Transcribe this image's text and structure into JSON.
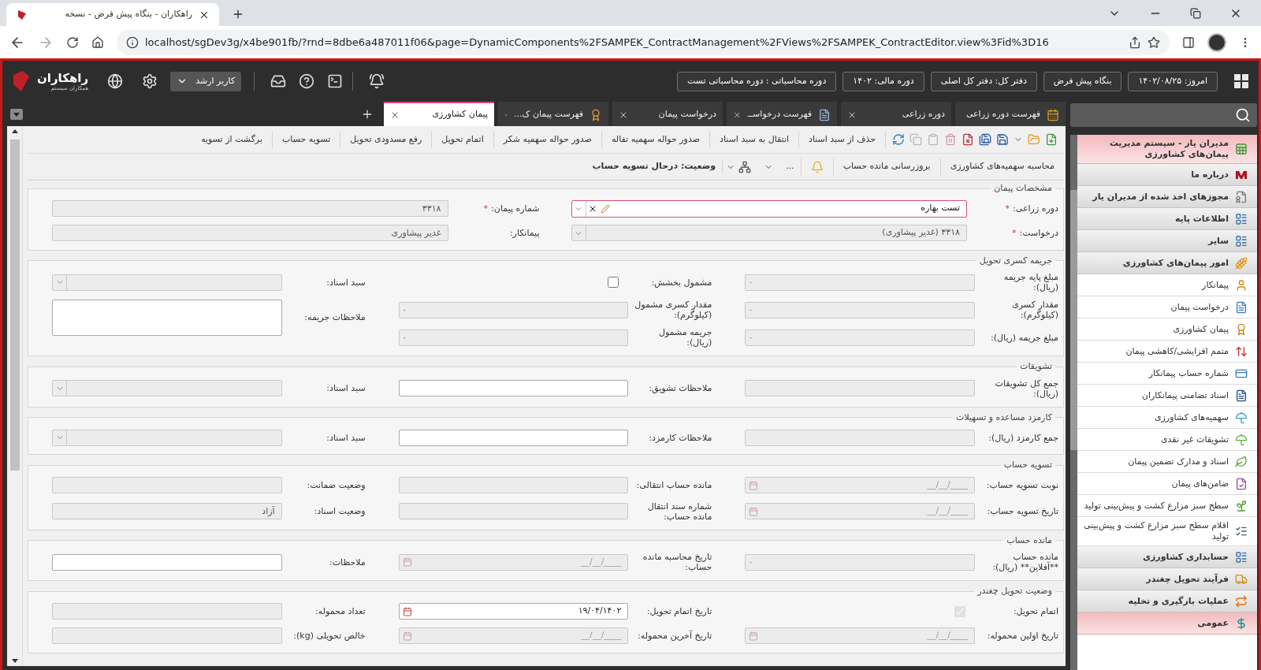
{
  "browser": {
    "tab_title": "راهکاران - بنگاه پیش فرض - نسخه",
    "url": "localhost/sgDev3g/x4be901fb/?rnd=8dbe6a487011f06&page=DynamicComponents%2FSAMPEK_ContractManagement%2FViews%2FSAMPEK_ContractEditor.view%3Fid%3D16"
  },
  "app_header": {
    "logo_title": "راهکاران",
    "logo_subtitle": "همکاران سیستم",
    "user_menu": "کاربر ارشد",
    "info": [
      "امروز: ۱۴۰۲/۰۸/۲۵",
      "بنگاه پیش فرض",
      "دفتر کل: دفتر کل اصلی",
      "دوره مالی: ۱۴۰۲",
      "دوره محاسباتی : دوره محاسباتی تست"
    ]
  },
  "doc_tabs": [
    {
      "label": "فهرست دوره زراعی",
      "selected": false
    },
    {
      "label": "دوره زراعی",
      "selected": false
    },
    {
      "label": "فهرست درخواســ",
      "selected": false
    },
    {
      "label": "درخواست پیمان",
      "selected": false
    },
    {
      "label": "فهرست پیمان ک...",
      "selected": false
    },
    {
      "label": "پیمان کشاورزی",
      "selected": true
    }
  ],
  "toolbar": {
    "row_1": [
      "حذف از سبد اسناد",
      "انتقال به سبد اسناد",
      "صدور حواله سهمیه تفاله",
      "صدور حواله سهمیه شکر",
      "اتمام تحویل",
      "رفع مسدودی تحویل",
      "تسویه حساب",
      "برگشت از تسویه"
    ],
    "row_2": [
      "محاسبه سهمیه‌های کشاورزی",
      "بروزرسانی مانده حساب"
    ],
    "more": "...",
    "status": "وضعیت: درحال تسویه حساب"
  },
  "sections": [
    {
      "title": "مشخصات پیمان",
      "kind": "two-column",
      "rows": [
        [
          {
            "label": "دوره زراعی:",
            "marker": "*",
            "kind": "lookup",
            "value": "تست بهاره",
            "disabled": false,
            "focused": true
          },
          {
            "label": "شماره پیمان:",
            "marker": "*",
            "kind": "text",
            "value": "۳۳۱۸",
            "disabled": true
          }
        ],
        [
          {
            "label": "درخواست:",
            "marker": "*",
            "kind": "select",
            "value": "۳۳۱۸ (غدیر پیشاوری)",
            "disabled": true
          },
          {
            "label": "پیمانکار:",
            "kind": "text",
            "value": "غدیر پیشاوری",
            "disabled": true
          }
        ]
      ]
    },
    {
      "title": "جریمه کسری تحویل",
      "kind": "three-column",
      "rows": [
        [
          {
            "label": "مبلغ پایه جریمه (ریال):",
            "kind": "number",
            "value": "۰",
            "disabled": true
          },
          {
            "label": "مشمول بخشش:",
            "kind": "checkbox",
            "checked": false,
            "disabled": false
          },
          {
            "label": "سبد اسناد:",
            "kind": "select",
            "disabled": true
          }
        ],
        [
          {
            "label": "مقدار کسری (کیلوگرم):",
            "kind": "number",
            "value": "۰",
            "disabled": true
          },
          {
            "label": "مقدار کسری مشمول (کیلوگرم):",
            "kind": "number",
            "value": "۰",
            "disabled": true
          },
          {
            "label": "ملاحظات جریمه:",
            "kind": "textarea",
            "disabled": false
          }
        ],
        [
          {
            "label": "مبلغ جریمه (ریال):",
            "kind": "number",
            "value": "۰",
            "disabled": true
          },
          {
            "label": "جریمه مشمول (ریال):",
            "kind": "number",
            "value": "۰",
            "disabled": true
          }
        ]
      ]
    },
    {
      "title": "تشویقات",
      "kind": "three-column",
      "rows": [
        [
          {
            "label": "جمع کل تشویقات (ریال):",
            "kind": "text",
            "disabled": true
          },
          {
            "label": "ملاحظات تشویق:",
            "kind": "text",
            "disabled": false
          },
          {
            "label": "سبد اسناد:",
            "kind": "select",
            "disabled": true
          }
        ]
      ]
    },
    {
      "title": "کارمزد مساعده و تسهیلات",
      "kind": "three-column",
      "rows": [
        [
          {
            "label": "جمع کارمزد (ریال):",
            "kind": "text",
            "disabled": true
          },
          {
            "label": "ملاحظات کارمزد:",
            "kind": "text",
            "disabled": false
          },
          {
            "label": "سبد اسناد:",
            "kind": "select",
            "disabled": true
          }
        ]
      ]
    },
    {
      "title": "تسویه حساب",
      "kind": "three-column",
      "rows": [
        [
          {
            "label": "نوبت تسویه حساب:",
            "kind": "date",
            "placeholder": "__/__/____",
            "disabled": true
          },
          {
            "label": "مانده حساب انتقالی:",
            "kind": "text",
            "disabled": true
          },
          {
            "label": "وضعیت ضمانت:",
            "kind": "text",
            "disabled": true
          }
        ],
        [
          {
            "label": "تاریخ تسویه حساب:",
            "kind": "date",
            "placeholder": "__/__/____",
            "disabled": true
          },
          {
            "label": "شماره سند انتقال مانده حساب:",
            "kind": "text",
            "disabled": true
          },
          {
            "label": "وضعیت اسناد:",
            "kind": "text",
            "value": "آزاد",
            "disabled": true
          }
        ]
      ]
    },
    {
      "title": "مانده حساب",
      "kind": "three-column",
      "rows": [
        [
          {
            "label": "مانده حساب **آفلاین** (ریال):",
            "kind": "number",
            "value": "۰",
            "disabled": true
          },
          {
            "label": "تاریخ محاسبه مانده حساب:",
            "kind": "date",
            "placeholder": "__/__/____",
            "disabled": true
          },
          {
            "label": "ملاحظات:",
            "kind": "text",
            "disabled": false
          }
        ]
      ]
    },
    {
      "title": "وضعیت تحویل چغندر",
      "kind": "three-column",
      "rows": [
        [
          {
            "label": "اتمام تحویل:",
            "kind": "checkbox",
            "checked": true,
            "disabled": true
          },
          {
            "label": "تاریخ اتمام تحویل:",
            "kind": "date",
            "value": "۱۹/۰۴/۱۴۰۲",
            "disabled": false
          },
          {
            "label": "تعداد محموله:",
            "kind": "text",
            "disabled": true
          }
        ],
        [
          {
            "label": "تاریخ اولین محموله:",
            "kind": "date",
            "placeholder": "__/__/____",
            "disabled": true
          },
          {
            "label": "تاریخ آخرین محموله:",
            "kind": "date",
            "placeholder": "__/__/____",
            "disabled": true
          },
          {
            "label": "خالص تحویلی (kg):",
            "kind": "text",
            "disabled": true
          }
        ]
      ]
    }
  ],
  "sidebar": {
    "items": [
      {
        "label": "مدیران یار - سیستم مدیریت پیمان‌های کشاورزی",
        "kind": "module"
      },
      {
        "label": "درباره ما",
        "kind": "group"
      },
      {
        "label": "مجوزهای اخذ شده از مدیران یار",
        "kind": "group"
      },
      {
        "label": "اطلاعات پایه",
        "kind": "group"
      },
      {
        "label": "سایر",
        "kind": "group"
      },
      {
        "label": "امور پیمان‌های کشاورزی",
        "kind": "group",
        "expanded": true,
        "children": [
          {
            "label": "پیمانکار"
          },
          {
            "label": "درخواست پیمان"
          },
          {
            "label": "پیمان کشاورزی"
          },
          {
            "label": "متمم افزایشی/کاهشی پیمان"
          },
          {
            "label": "شماره حساب پیمانکار"
          },
          {
            "label": "اسناد تضامنی پیمانکاران"
          },
          {
            "label": "سهمیه‌های کشاورزی"
          },
          {
            "label": "تشویقات غیر نقدی"
          },
          {
            "label": "اسناد و مدارک تضمین پیمان"
          },
          {
            "label": "ضامن‌های پیمان"
          },
          {
            "label": "سطح سبز مزارع کشت و پیش‌بینی تولید"
          },
          {
            "label": "اقلام سطح سبز مزارع کشت و پیش‌بینی تولید"
          }
        ]
      },
      {
        "label": "حسابداری کشاورزی",
        "kind": "group"
      },
      {
        "label": "فرآیند تحویل چغندر",
        "kind": "group"
      },
      {
        "label": "عملیات بارگیری و تخلیه",
        "kind": "group"
      },
      {
        "label": "عمومی",
        "kind": "module"
      }
    ]
  }
}
